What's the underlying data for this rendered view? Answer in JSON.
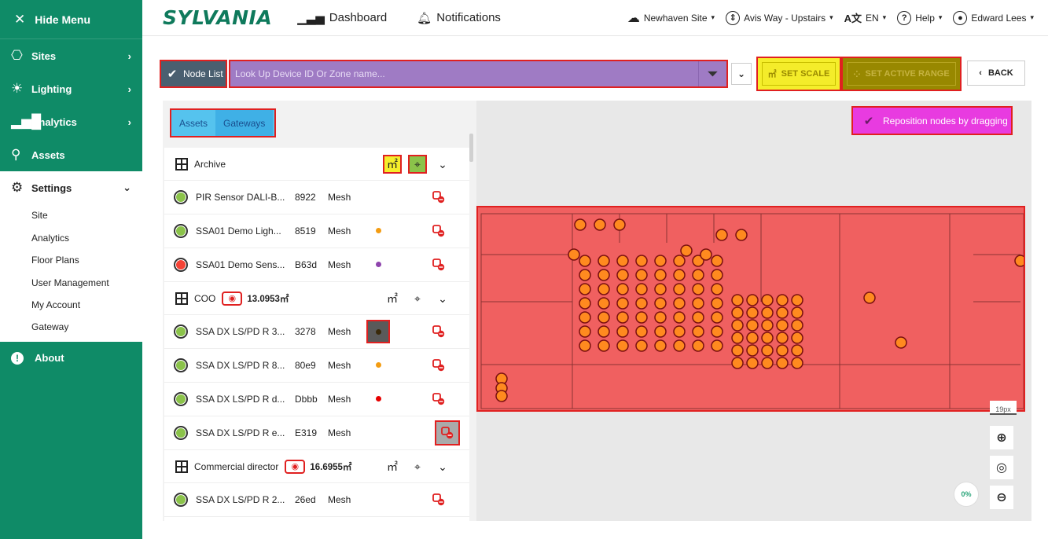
{
  "sidebar": {
    "hide_menu": "Hide Menu",
    "items": [
      {
        "label": "Sites"
      },
      {
        "label": "Lighting"
      },
      {
        "label": "Analytics"
      },
      {
        "label": "Assets"
      },
      {
        "label": "Settings"
      }
    ],
    "settings_sub": [
      "Site",
      "Analytics",
      "Floor Plans",
      "User Management",
      "My Account",
      "Gateway"
    ],
    "about": "About"
  },
  "header": {
    "logo": "SYLVANIA",
    "dashboard": "Dashboard",
    "notifications": "Notifications",
    "site": "Newhaven Site",
    "floor": "Avis Way - Upstairs",
    "lang": "EN",
    "help": "Help",
    "user": "Edward Lees"
  },
  "toolbar": {
    "node_list": "Node List",
    "search_placeholder": "Look Up Device ID Or Zone name...",
    "set_scale": "SET SCALE",
    "set_active_range": "SET ACTIVE RANGE",
    "back": "BACK"
  },
  "panel": {
    "tabs": [
      "Assets",
      "Gateways"
    ],
    "zones": [
      {
        "name": "Archive",
        "area": "",
        "devices": [
          {
            "name": "PIR Sensor DALI-B...",
            "id": "8922",
            "type": "Mesh",
            "color": "#8bc34a",
            "status": ""
          },
          {
            "name": "SSA01 Demo Ligh...",
            "id": "8519",
            "type": "Mesh",
            "color": "#8bc34a",
            "status": "#f39c12"
          },
          {
            "name": "SSA01 Demo Sens...",
            "id": "B63d",
            "type": "Mesh",
            "color": "#f44336",
            "status": "#8e44ad"
          }
        ]
      },
      {
        "name": "COO",
        "area": "13.0953㎡",
        "devices": [
          {
            "name": "SSA DX LS/PD R 3...",
            "id": "3278",
            "type": "Mesh",
            "color": "#8bc34a",
            "status": "#4a4a4a"
          },
          {
            "name": "SSA DX LS/PD R 8...",
            "id": "80e9",
            "type": "Mesh",
            "color": "#8bc34a",
            "status": "#f39c12"
          },
          {
            "name": "SSA DX LS/PD R d...",
            "id": "Dbbb",
            "type": "Mesh",
            "color": "#8bc34a",
            "status": "#e60000"
          },
          {
            "name": "SSA DX LS/PD R e...",
            "id": "E319",
            "type": "Mesh",
            "color": "#8bc34a",
            "status": ""
          }
        ]
      },
      {
        "name": "Commercial director",
        "area": "16.6955㎡",
        "devices": [
          {
            "name": "SSA DX LS/PD R 2...",
            "id": "26ed",
            "type": "Mesh",
            "color": "#8bc34a",
            "status": ""
          }
        ]
      }
    ]
  },
  "map": {
    "reposition": "Reposition nodes by dragging",
    "scale_label": "19px",
    "progress": "0%"
  },
  "colors": {
    "brand": "#0f8b67",
    "highlight_red": "#e02020"
  }
}
